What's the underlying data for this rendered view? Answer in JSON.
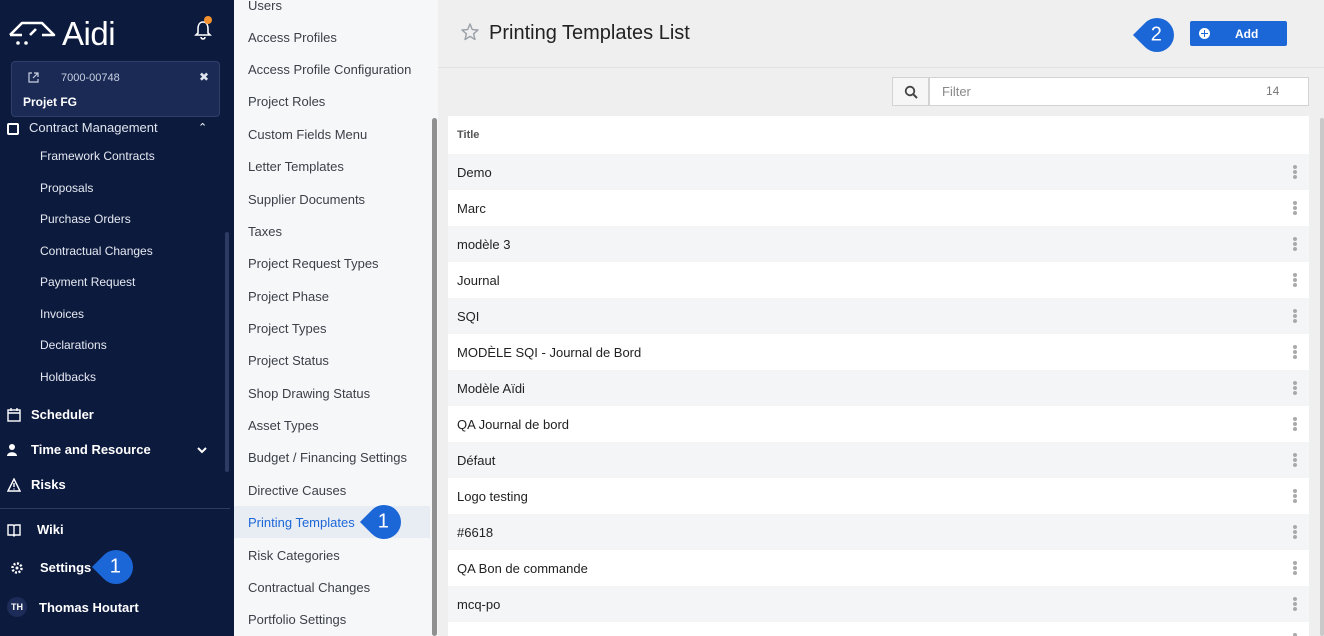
{
  "app": {
    "brand": "Aidi",
    "project": {
      "code": "7000-00748",
      "name": "Projet FG"
    }
  },
  "nav": {
    "section_header": "Contract Management",
    "sub_items": [
      "Framework Contracts",
      "Proposals",
      "Purchase Orders",
      "Contractual Changes",
      "Payment Request",
      "Invoices",
      "Declarations",
      "Holdbacks"
    ],
    "main_items": [
      {
        "label": "Scheduler",
        "icon": "calendar-icon"
      },
      {
        "label": "Time and Resource",
        "icon": "user-clock-icon"
      },
      {
        "label": "Risks",
        "icon": "warning-icon"
      },
      {
        "label": "Wiki",
        "icon": "book-icon"
      },
      {
        "label": "Settings",
        "icon": "gear-icon"
      }
    ],
    "user": {
      "initials": "TH",
      "name": "Thomas Houtart"
    }
  },
  "settings_menu": {
    "items": [
      "Users",
      "Access Profiles",
      "Access Profile Configuration",
      "Project Roles",
      "Custom Fields Menu",
      "Letter Templates",
      "Supplier Documents",
      "Taxes",
      "Project Request Types",
      "Project Phase",
      "Project Types",
      "Project Status",
      "Shop Drawing Status",
      "Asset Types",
      "Budget / Financing Settings",
      "Directive Causes",
      "Printing Templates",
      "Risk Categories",
      "Contractual Changes",
      "Portfolio Settings"
    ],
    "active": "Printing Templates"
  },
  "callouts": {
    "menu": "1",
    "nav": "1",
    "add": "2"
  },
  "page": {
    "title": "Printing Templates List",
    "add_label": "Add",
    "filter_placeholder": "Filter",
    "count": "14"
  },
  "table": {
    "column": "Title",
    "rows": [
      "Demo",
      "Marc",
      "modèle 3",
      "Journal",
      "SQI",
      "MODÈLE SQI - Journal de Bord",
      "Modèle Aïdi",
      "QA Journal de bord",
      "Défaut",
      "Logo testing",
      "#6618",
      "QA Bon de commande",
      "mcq-po"
    ]
  },
  "colors": {
    "nav_bg": "#0c1a3d",
    "accent": "#1c67d8",
    "notification": "#f5922f"
  }
}
